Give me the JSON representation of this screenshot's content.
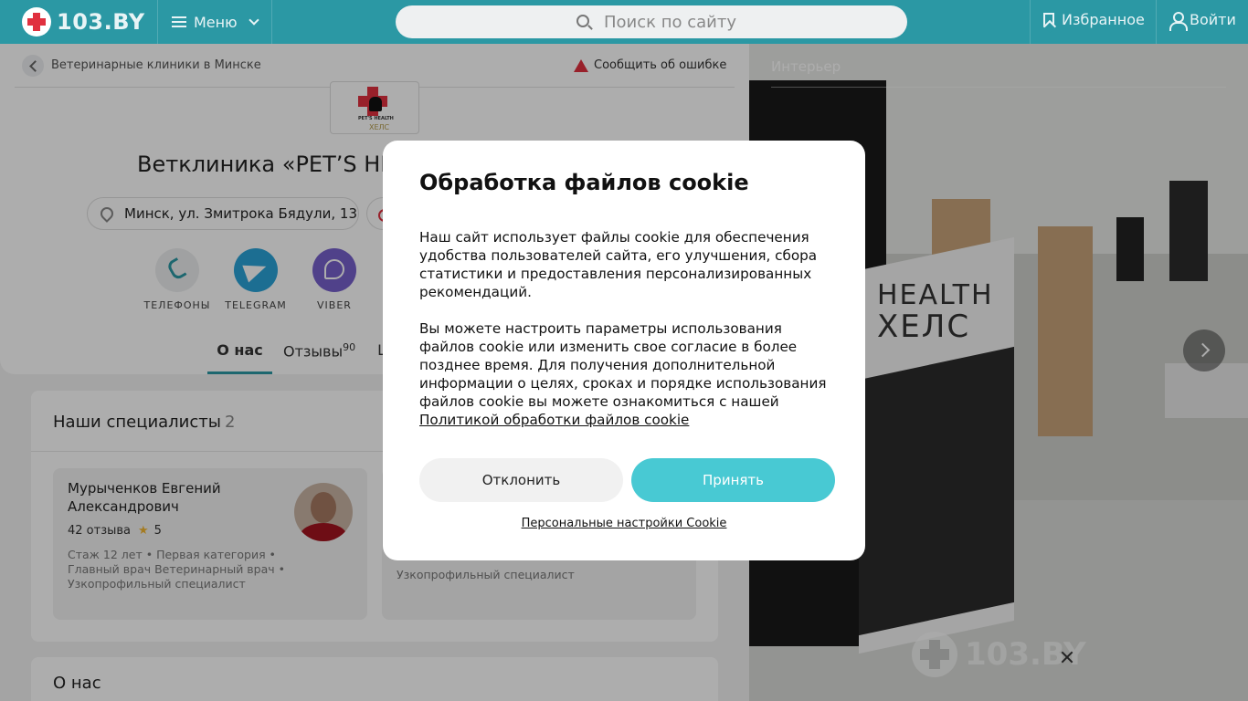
{
  "header": {
    "logo_text": "103.BY",
    "menu_label": "Меню",
    "search_placeholder": "Поиск по сайту",
    "favorites_label": "Избранное",
    "login_label": "Войти",
    "bg_color": "#2b98a4"
  },
  "clinic": {
    "breadcrumb": "Ветеринарные клиники в Минске",
    "report_error": "Сообщить об ошибке",
    "logo_text_line1": "PET'S HEALTH",
    "logo_text_line2": "ХЕЛС",
    "title": "Ветклиника «PET’S HEALTH»",
    "address": "Минск, ул. Змитрока Бядули, 13",
    "contacts": [
      {
        "label": "ТЕЛЕФОНЫ",
        "icon": "phone-icon"
      },
      {
        "label": "TELEGRAM",
        "icon": "telegram-icon"
      },
      {
        "label": "VIBER",
        "icon": "viber-icon"
      }
    ],
    "tabs": [
      {
        "label": "О нас",
        "count": ""
      },
      {
        "label": "Отзывы",
        "count": "90"
      },
      {
        "label": "Ц",
        "count": ""
      }
    ]
  },
  "specialists": {
    "title": "Наши специалисты",
    "count": "2",
    "items": [
      {
        "name": "Мурыченков Евгений Александрович",
        "reviews": "42 отзыва",
        "rating": "5",
        "meta": "Стаж 12 лет • Первая категория • Главный врач Ветеринарный врач • Узкопрофильный специалист"
      },
      {
        "meta": "Узкопрофильный специалист"
      }
    ]
  },
  "about": {
    "title": "О нас"
  },
  "gallery": {
    "label": "Интерьер",
    "banner_line1": "HEALTH",
    "banner_line2": "ХЕЛС",
    "watermark": "103.BY"
  },
  "cookie_modal": {
    "title": "Обработка файлов cookie",
    "paragraph1": "Наш сайт использует файлы cookie для обеспечения удобства пользователей сайта, его улучшения, сбора статистики и предоставления персонализированных рекомендаций.",
    "paragraph2": "Вы можете настроить параметры использования файлов cookie или изменить свое согласие в более позднее время. Для получения дополнительной информации о целях, сроках и порядке использования файлов cookie вы можете ознакомиться с нашей",
    "policy_link": "Политикой обработки файлов cookie",
    "decline_label": "Отклонить",
    "accept_label": "Принять",
    "settings_link": "Персональные настройки Cookie",
    "accept_color": "#48c9d3"
  }
}
